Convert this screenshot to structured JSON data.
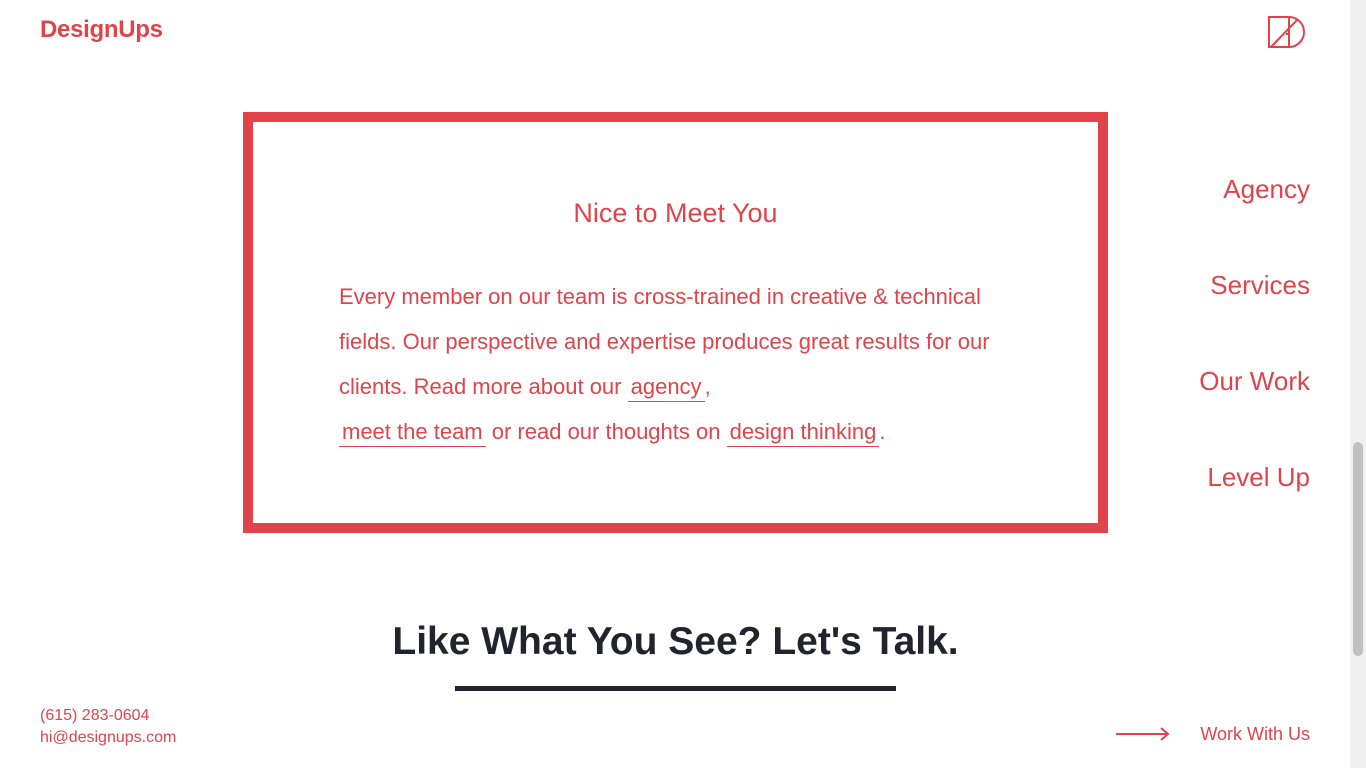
{
  "header": {
    "logo_text": "DesignUps",
    "brand_mark_icon": "designups-monogram-icon"
  },
  "card": {
    "title": "Nice to Meet You",
    "body_intro": "Every member on our team is cross-trained in creative & technical fields. Our perspective and expertise produces great results for our clients. Read more about our ",
    "link_agency": "agency",
    "sep_comma": ",",
    "link_team": "meet the team",
    "body_mid": " or read our thoughts on ",
    "link_design": "design thinking",
    "body_end": "."
  },
  "nav": {
    "items": [
      {
        "label": "Agency"
      },
      {
        "label": "Services"
      },
      {
        "label": "Our Work"
      },
      {
        "label": "Level Up"
      }
    ]
  },
  "cta": {
    "heading": "Like What You See? Let's Talk."
  },
  "footer": {
    "phone": "(615) 283-0604",
    "email": "hi@designups.com",
    "work_with_label": "Work With Us",
    "arrow_icon": "arrow-right-icon"
  },
  "colors": {
    "brand_red": "#e0434a",
    "dark_text": "#23232f"
  }
}
